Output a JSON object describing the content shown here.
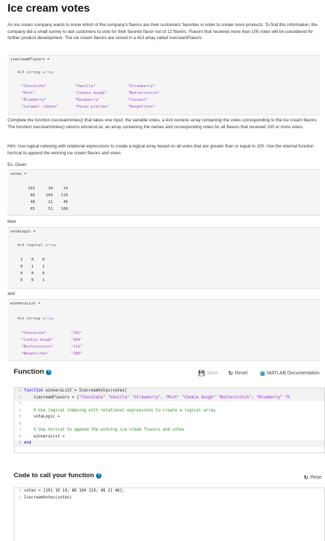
{
  "page": {
    "title": "Ice cream votes",
    "intro": "An ice cream company wants to know which of the company's flavors are their customers' favorites in order to create more products. To find this information, the company did a small survey to ask customers to vote for their favorite flavor out of 12 flavors. Flavors that received more than 100 votes will be considered for further product development. The ice cream flavors are stored in a 4x3 array called IcecreamFlavors:",
    "task": "Complete the function IcecreamVotes() that takes one input: the variable votes, a 4x3 numeric array containing the votes corresponding to the ice cream flavors. The function IcecreamVotes() returns winnersList, an array containing the names and corresponding votes for all flavors that received 100 or more votes.",
    "hint": "Hint: Use logical indexing with relational expressions to create a logical array based on all votes that are greater than or equal to 100. Use the internal function horzcat to append the winning ice cream flavors and votes.",
    "ex_given": "Ex. Given",
    "then": "then",
    "and": "and"
  },
  "flavors_box": {
    "var": "icecreamFlavors =",
    "dim": "4×3",
    "type_label": "string",
    "type_kw": "array",
    "cells": [
      [
        "\"Chocolate\"",
        "\"Vanilla\"",
        "\"Strawberry\""
      ],
      [
        "\"Mint\"",
        "\"Cookie dough\"",
        "\"Butterscotch\""
      ],
      [
        "\"Blueberry\"",
        "\"Raspberry\"",
        "\"Coconut\""
      ],
      [
        "\"Caramel ribbon\"",
        "\"Pecan praline\"",
        "\"Neopolitan\""
      ]
    ]
  },
  "votes_box": {
    "var": "votes =",
    "rows": [
      [
        "101",
        "10",
        "14"
      ],
      [
        "86",
        "104",
        "119"
      ],
      [
        "48",
        "21",
        "46"
      ],
      [
        "65",
        "51",
        "108"
      ]
    ]
  },
  "logic_box": {
    "var": "voteLogic =",
    "dim": "4×3",
    "type_label": "logical",
    "type_kw": "array",
    "rows": [
      [
        "1",
        "0",
        "0"
      ],
      [
        "0",
        "1",
        "1"
      ],
      [
        "0",
        "0",
        "0"
      ],
      [
        "0",
        "0",
        "1"
      ]
    ]
  },
  "winners_box": {
    "var": "winnersList =",
    "dim": "4×2",
    "type_label": "string",
    "type_kw": "array",
    "rows": [
      [
        "\"Chocolate\"",
        "\"101\""
      ],
      [
        "\"Cookie dough\"",
        "\"104\""
      ],
      [
        "\"Butterscotch\"",
        "\"119\""
      ],
      [
        "\"Neopolitan\"",
        "\"108\""
      ]
    ]
  },
  "function_section": {
    "title": "Function",
    "save": "Save",
    "reset": "Reset",
    "matlab_docs": "MATLAB Documentation",
    "lines": [
      {
        "n": "1",
        "parts": [
          [
            "k",
            "function "
          ],
          [
            "t",
            "winnersList = IcecreamVotes(votes)"
          ]
        ],
        "locked": true
      },
      {
        "n": "2",
        "parts": [
          [
            "t",
            "    icecreamFlavors = ["
          ],
          [
            "s",
            "\"Chocolate\" \"Vanilla\" \"Strawberry\"; \"Mint\" \"Cookie dough\" \"Butterscotch\"; \"Blueberry\" \"R"
          ]
        ],
        "locked": true
      },
      {
        "n": "3",
        "parts": [
          [
            "t",
            ""
          ]
        ],
        "locked": false
      },
      {
        "n": "4",
        "parts": [
          [
            "c",
            "    % Use logical indexing with relational expressions to create a logical array"
          ]
        ],
        "locked": false
      },
      {
        "n": "5",
        "parts": [
          [
            "t",
            "    voteLogic ="
          ]
        ],
        "locked": false
      },
      {
        "n": "6",
        "parts": [
          [
            "t",
            ""
          ]
        ],
        "locked": false
      },
      {
        "n": "7",
        "parts": [
          [
            "c",
            "    % Use horzcat to append the winning ice cream flavors and votes"
          ]
        ],
        "locked": false
      },
      {
        "n": "8",
        "parts": [
          [
            "t",
            "    winnersList ="
          ]
        ],
        "locked": false
      },
      {
        "n": "9",
        "parts": [
          [
            "k",
            "end"
          ]
        ],
        "locked": true
      }
    ]
  },
  "call_section": {
    "title": "Code to call your function",
    "reset": "Rese",
    "lines": [
      {
        "n": "1",
        "text": "votes = [101 10 14; 86 104 119; 48 21 46];"
      },
      {
        "n": "2",
        "text": "IcecreamVotes(votes)"
      }
    ]
  }
}
